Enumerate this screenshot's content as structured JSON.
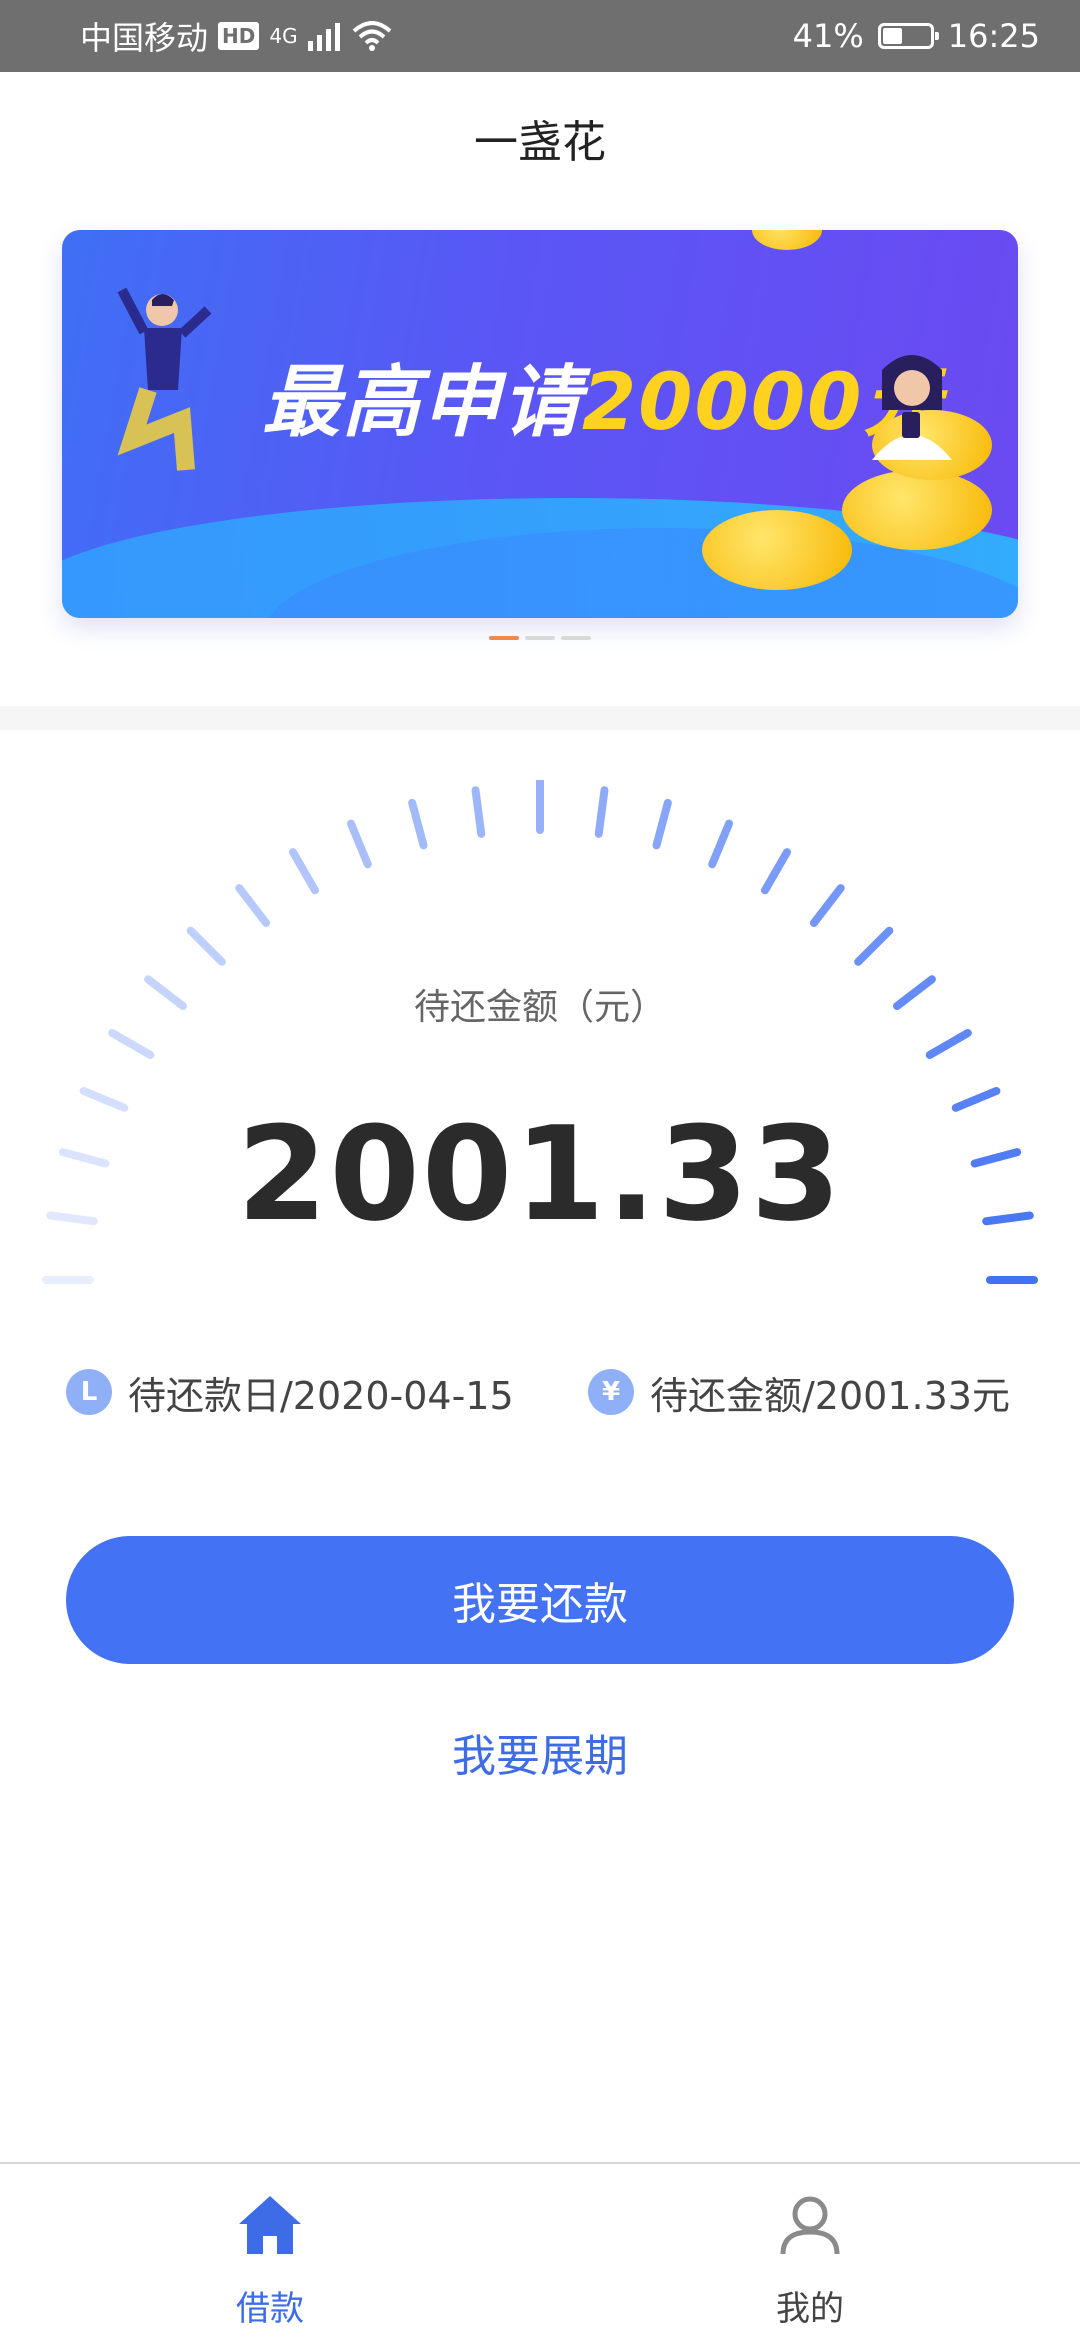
{
  "status_bar": {
    "carrier": "中国移动",
    "hd": "HD",
    "network": "4G",
    "battery": "41%",
    "battery_level": 0.41,
    "time": "16:25"
  },
  "header": {
    "title": "一盏花"
  },
  "banner": {
    "text_prefix": "最高申请",
    "text_amount": "20000元",
    "page_count": 3,
    "active_index": 0
  },
  "gauge": {
    "label": "待还金额（元）",
    "value": "2001.33"
  },
  "info": {
    "due_date_icon": "L",
    "due_date": "待还款日/2020-04-15",
    "amount_icon": "¥",
    "amount": "待还金额/2001.33元"
  },
  "actions": {
    "repay_label": "我要还款",
    "extend_label": "我要展期"
  },
  "tabs": [
    {
      "label": "借款",
      "icon": "home-icon",
      "active": true
    },
    {
      "label": "我的",
      "icon": "user-icon",
      "active": false
    }
  ],
  "colors": {
    "accent": "#4372f5",
    "banner_highlight": "#ffd21f",
    "status_bar": "#6f6f6f"
  }
}
